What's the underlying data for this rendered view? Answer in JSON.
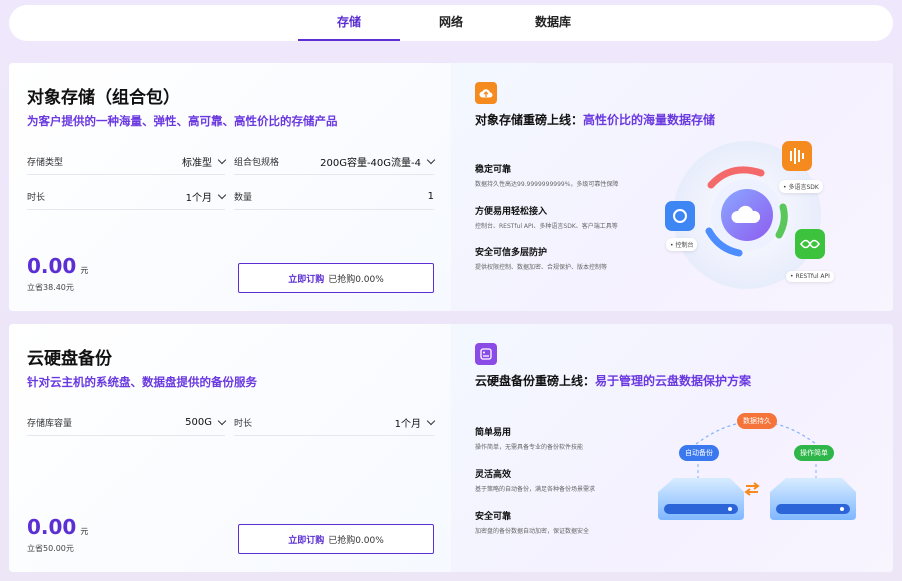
{
  "tabs": [
    {
      "label": "存储",
      "active": true
    },
    {
      "label": "网络",
      "active": false
    },
    {
      "label": "数据库",
      "active": false
    }
  ],
  "card1": {
    "title": "对象存储（组合包）",
    "subtitle": "为客户提供的一种海量、弹性、高可靠、高性价比的存储产品",
    "fields": [
      {
        "label": "存储类型",
        "value": "标准型"
      },
      {
        "label": "组合包规格",
        "value": "200G容量-40G流量-4"
      },
      {
        "label": "时长",
        "value": "1个月"
      },
      {
        "label": "数量",
        "value": "1"
      }
    ],
    "price": "0.00",
    "price_unit": "元",
    "save": "立省38.40元",
    "buy_label": "立即订购",
    "buy_note": "已抢购0.00%",
    "promo_title": "对象存储重磅上线：",
    "promo_highlight": "高性价比的海量数据存储",
    "features": [
      {
        "title": "稳定可靠",
        "desc": "数据持久性高达99.9999999999%，多级可靠性保障"
      },
      {
        "title": "方便易用轻松接入",
        "desc": "控制台、RESTful API、多种语言SDK、客户端工具等"
      },
      {
        "title": "安全可信多层防护",
        "desc": "提供权限控制、数据加密、合规保护、版本控制等"
      }
    ],
    "illus_labels": {
      "sdk": "• 多语言SDK",
      "console": "• 控制台",
      "api": "• RESTful API"
    }
  },
  "card2": {
    "title": "云硬盘备份",
    "subtitle": "针对云主机的系统盘、数据盘提供的备份服务",
    "fields": [
      {
        "label": "存储库容量",
        "value": "500G"
      },
      {
        "label": "时长",
        "value": "1个月"
      }
    ],
    "price": "0.00",
    "price_unit": "元",
    "save": "立省50.00元",
    "buy_label": "立即订购",
    "buy_note": "已抢购0.00%",
    "promo_title": "云硬盘备份重磅上线：",
    "promo_highlight": "易于管理的云盘数据保护方案",
    "features": [
      {
        "title": "简单易用",
        "desc": "操作简单，无需具备专业的备份软件技能"
      },
      {
        "title": "灵活高效",
        "desc": "基于策略的自动备份，满足各种备份场景需求"
      },
      {
        "title": "安全可靠",
        "desc": "加密盘的备份数据自动加密，保证数据安全"
      }
    ],
    "illus_labels": {
      "persist": "数据持久",
      "auto": "自动备份",
      "simple": "操作简单"
    }
  },
  "colors": {
    "accent": "#5b2fd3",
    "subtitle": "#6a39e0",
    "orange": "#f58a1f",
    "purple_icon": "#8b4be6"
  }
}
